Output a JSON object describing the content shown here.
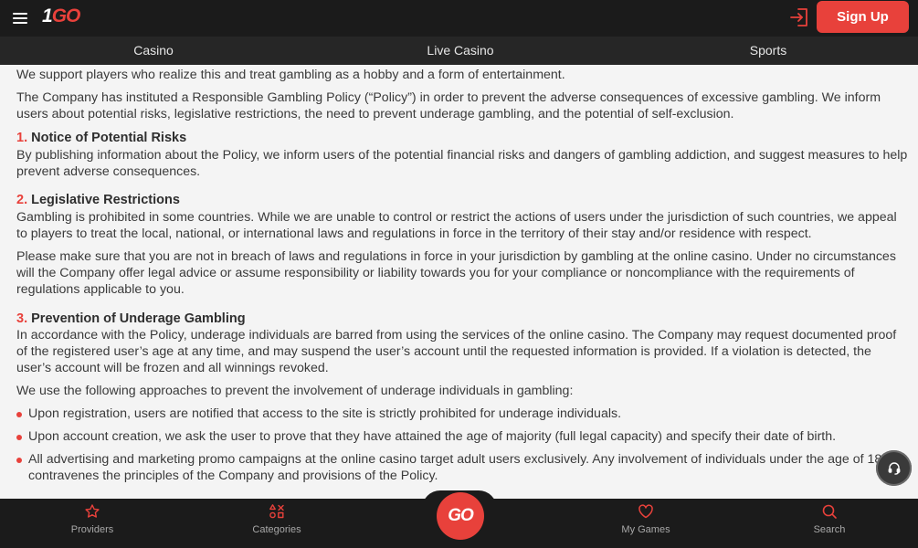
{
  "header": {
    "logo_part1": "1",
    "logo_part2": "GO",
    "signup_label": "Sign Up"
  },
  "nav": {
    "items": [
      {
        "label": "Casino"
      },
      {
        "label": "Live Casino"
      },
      {
        "label": "Sports"
      }
    ]
  },
  "content": {
    "intro": [
      "We support players who realize this and treat gambling as a hobby and a form of entertainment.",
      "The Company has instituted a Responsible Gambling Policy (“Policy”) in order to prevent the adverse consequences of excessive gambling. We inform users about potential risks, legislative restrictions, the need to prevent underage gambling, and the potential of self-exclusion."
    ],
    "sections": [
      {
        "num": "1.",
        "title": "Notice of Potential Risks",
        "paragraphs": [
          "By publishing information about the Policy, we inform users of the potential financial risks and dangers of gambling addiction, and suggest measures to help prevent adverse consequences."
        ]
      },
      {
        "num": "2.",
        "title": "Legislative Restrictions",
        "paragraphs": [
          "Gambling is prohibited in some countries. While we are unable to control or restrict the actions of users under the jurisdiction of such countries, we appeal to players to treat the local, national, or international laws and regulations in force in the territory of their stay and/or residence with respect.",
          "Please make sure that you are not in breach of laws and regulations in force in your jurisdiction by gambling at the online casino. Under no circumstances will the Company offer legal advice or assume responsibility or liability towards you for your compliance or noncompliance with the requirements of regulations applicable to you."
        ]
      },
      {
        "num": "3.",
        "title": "Prevention of Underage Gambling",
        "paragraphs": [
          "In accordance with the Policy, underage individuals are barred from using the services of the online casino. The Company may request documented proof of the registered user’s age at any time, and may suspend the user’s account until the requested information is provided. If a violation is detected, the user’s account will be frozen and all winnings revoked.",
          "We use the following approaches to prevent the involvement of underage individuals in gambling:"
        ],
        "bullets": [
          "Upon registration, users are notified that access to the site is strictly prohibited for underage individuals.",
          "Upon account creation, we ask the user to prove that they have attained the age of majority (full legal capacity) and specify their date of birth.",
          "All advertising and marketing promo campaigns at the online casino target adult users exclusively. Any involvement of individuals under the age of 18 contravenes the principles of the Company and provisions of the Policy."
        ]
      }
    ]
  },
  "bottom_nav": {
    "providers": "Providers",
    "categories": "Categories",
    "go_label": "GO",
    "my_games": "My Games",
    "search": "Search"
  },
  "colors": {
    "accent": "#e8413b",
    "header_bg": "#1b1b1b",
    "nav_bg": "#262626",
    "content_bg": "#f4f4f4"
  },
  "icons": [
    "menu-icon",
    "login-icon",
    "support-headset-icon",
    "star-icon",
    "categories-icon",
    "heart-icon",
    "search-icon"
  ]
}
